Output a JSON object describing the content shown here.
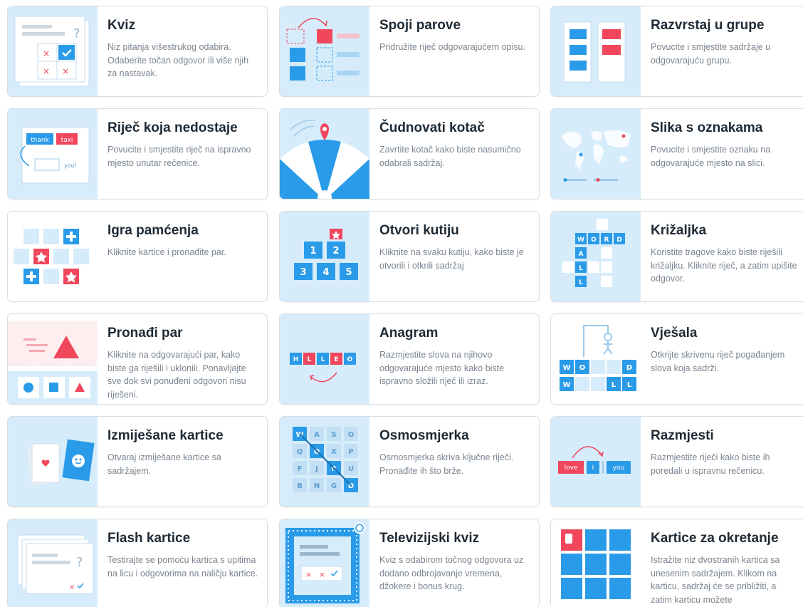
{
  "colors": {
    "blue": "#2a9be8",
    "red": "#f0475d",
    "light_blue": "#d6ecfb",
    "text": "#1e2a35",
    "desc": "#7a8591"
  },
  "templates": [
    {
      "title": "Kviz",
      "desc": "Niz pitanja višestrukog odabira. Odaberite točan odgovor ili više njih za nastavak.",
      "icon": "quiz-icon"
    },
    {
      "title": "Spoji parove",
      "desc": "Pridružite riječ odgovarajućem opisu.",
      "icon": "match-pairs-icon"
    },
    {
      "title": "Razvrstaj u grupe",
      "desc": "Povucite i smjestite sadržaje u odgovarajuću grupu.",
      "icon": "group-sort-icon"
    },
    {
      "title": "Riječ koja nedostaje",
      "desc": "Povucite i smjestite riječ na ispravno mjesto unutar rečenice.",
      "icon": "missing-word-icon",
      "words": [
        "thank",
        "taxi",
        "you!"
      ]
    },
    {
      "title": "Čudnovati kotač",
      "desc": "Zavrtite kotač kako biste nasumično odabrali sadržaj.",
      "icon": "spin-wheel-icon"
    },
    {
      "title": "Slika s oznakama",
      "desc": "Povucite i smjestite oznaku na odgovarajuće mjesto na slici.",
      "icon": "labelled-map-icon"
    },
    {
      "title": "Igra pamćenja",
      "desc": "Kliknite kartice i pronađite par.",
      "icon": "memory-game-icon"
    },
    {
      "title": "Otvori kutiju",
      "desc": "Kliknite na svaku kutiju, kako biste je otvorili i otkrili sadržaj",
      "icon": "open-box-icon",
      "numbers": [
        "1",
        "2",
        "3",
        "4",
        "5"
      ]
    },
    {
      "title": "Križaljka",
      "desc": "Koristite tragove kako biste riješili križaljku. Kliknite riječ, a zatim upišite odgovor.",
      "icon": "crossword-icon",
      "letters": [
        "W",
        "O",
        "R",
        "D",
        "A",
        "L",
        "L"
      ]
    },
    {
      "title": "Pronađi par",
      "desc": "Kliknite na odgovarajući par, kako biste ga riješili i uklonili. Ponavljajte sve dok svi ponuđeni odgovori nisu riješeni.",
      "icon": "find-match-icon"
    },
    {
      "title": "Anagram",
      "desc": "Razmjestite slova na njihovo odgovarajuće mjesto kako biste ispravno složili riječ ili izraz.",
      "icon": "anagram-icon",
      "letters": [
        "H",
        "L",
        "L",
        "E",
        "O"
      ]
    },
    {
      "title": "Vješala",
      "desc": "Otkrijte skrivenu riječ pogađanjem slova koja sadrži.",
      "icon": "hangman-icon",
      "letters": [
        "W",
        "O",
        "D",
        "W",
        "L",
        "L"
      ]
    },
    {
      "title": "Izmiješane kartice",
      "desc": "Otvaraj izmiješane kartice sa sadržajem.",
      "icon": "shuffled-cards-icon"
    },
    {
      "title": "Osmosmjerka",
      "desc": "Osmosmjerka skriva ključne riječi. Pronađite ih što brže.",
      "icon": "wordsearch-icon",
      "letters": [
        "W",
        "A",
        "S",
        "O",
        "Q",
        "O",
        "X",
        "P",
        "F",
        "J",
        "R",
        "U",
        "B",
        "N",
        "G",
        "D"
      ]
    },
    {
      "title": "Razmjesti",
      "desc": "Razmjestite riječi kako biste ih poredali u ispravnu rečenicu.",
      "icon": "unjumble-icon",
      "words": [
        "love",
        "I",
        "you"
      ]
    },
    {
      "title": "Flash kartice",
      "desc": "Testirajte se pomoću kartica s upitima na licu i odgovorima na naličju kartice.",
      "icon": "flash-cards-icon"
    },
    {
      "title": "Televizijski kviz",
      "desc": "Kviz s odabirom točnog odgovora uz dodano odbrojavanje vremena, džokere i bonus krug.",
      "icon": "tv-quiz-icon"
    },
    {
      "title": "Kartice za okretanje",
      "desc": "Istražite niz dvostranih kartica sa unesenim sadržajem. Klikom na karticu, sadržaj će se približiti, a zatim karticu možete",
      "icon": "flip-tiles-icon"
    }
  ]
}
